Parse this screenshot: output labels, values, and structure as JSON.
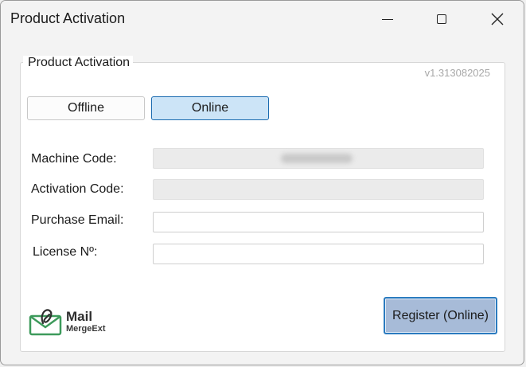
{
  "window": {
    "title": "Product Activation"
  },
  "group": {
    "title": "Product Activation",
    "version": "v1.313082025"
  },
  "mode": {
    "offline_label": "Offline",
    "online_label": "Online",
    "selected": "Online"
  },
  "fields": {
    "machine_code": {
      "label": "Machine Code:",
      "value": "",
      "value_obscured": true
    },
    "activation_code": {
      "label": "Activation Code:",
      "value": ""
    },
    "purchase_email": {
      "label": "Purchase Email:",
      "value": "",
      "placeholder": ""
    },
    "license_no": {
      "label": "License Nº:",
      "value": "",
      "placeholder": ""
    }
  },
  "logo": {
    "name": "Mail",
    "sub": "MergeExt",
    "accent": "#3d9a5b"
  },
  "actions": {
    "register_label": "Register (Online)"
  }
}
